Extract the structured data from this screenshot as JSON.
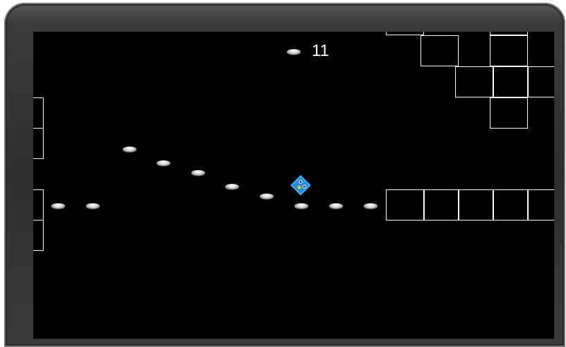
{
  "hud": {
    "score": "11",
    "score_icon": "coin-icon"
  },
  "colors": {
    "screen_background": "#000000",
    "block_outline": "#ffffff",
    "player_body": "#1e90e0",
    "coin": "#c8c8c8"
  },
  "player": {
    "icon": "blue-bird-diamond-icon"
  }
}
